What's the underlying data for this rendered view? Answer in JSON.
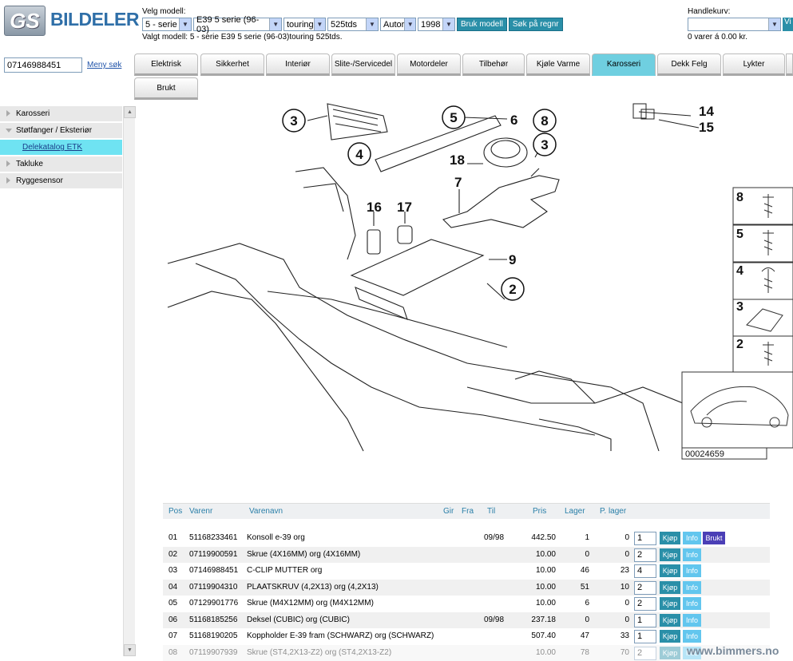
{
  "header": {
    "logo_mark": "GS",
    "logo_text": "BILDELER",
    "model_label": "Velg modell:",
    "selects": [
      {
        "value": "5 - serie"
      },
      {
        "value": "E39 5 serie (96-03)"
      },
      {
        "value": "touring"
      },
      {
        "value": "525tds"
      },
      {
        "value": "Autor"
      },
      {
        "value": "1998"
      }
    ],
    "use_model_button": "Bruk modell",
    "search_reg_button": "Søk på regnr",
    "selected_model": "Valgt modell: 5 - serie E39 5 serie (96-03)touring 525tds.",
    "cart_label": "Handlekurv:",
    "cart_select_value": "",
    "cart_button": "Vi",
    "cart_status": "0 varer á 0.00 kr."
  },
  "search": {
    "value": "07146988451",
    "menu_search_link": "Meny søk"
  },
  "tabs": [
    {
      "label": "Elektrisk"
    },
    {
      "label": "Sikkerhet"
    },
    {
      "label": "Interiør"
    },
    {
      "label": "Slite-/Servicedel"
    },
    {
      "label": "Motordeler"
    },
    {
      "label": "Tilbehør"
    },
    {
      "label": "Kjøle Varme"
    },
    {
      "label": "Karosseri"
    },
    {
      "label": "Dekk Felg"
    },
    {
      "label": "Lykter"
    },
    {
      "label": "Brukt"
    }
  ],
  "active_tab": "Karosseri",
  "sidebar": {
    "items": [
      {
        "label": "Karosseri"
      },
      {
        "label": "Støtfanger / Eksteriør"
      },
      {
        "label": "Delekatalog ETK"
      },
      {
        "label": "Takluke"
      },
      {
        "label": "Ryggesensor"
      }
    ]
  },
  "diagram": {
    "callouts": [
      "3",
      "5",
      "6",
      "8",
      "4",
      "3",
      "18",
      "14",
      "15",
      "7",
      "16",
      "17",
      "9",
      "2"
    ],
    "legend": [
      "8",
      "5",
      "4",
      "3",
      "2"
    ],
    "ref_number": "00024659"
  },
  "table": {
    "headers": [
      "Pos",
      "Varenr",
      "Varenavn",
      "Gir",
      "Fra",
      "Til",
      "Pris",
      "Lager",
      "P. lager"
    ],
    "rows": [
      {
        "pos": "01",
        "varenr": "51168233461",
        "navn": "Konsoll e-39 org",
        "til": "09/98",
        "pris": "442.50",
        "lager": "1",
        "plager": "0",
        "qty": "1",
        "brukt": true
      },
      {
        "pos": "02",
        "varenr": "07119900591",
        "navn": "Skrue (4X16MM) org (4X16MM)",
        "til": "",
        "pris": "10.00",
        "lager": "0",
        "plager": "0",
        "qty": "2",
        "brukt": false
      },
      {
        "pos": "03",
        "varenr": "07146988451",
        "navn": "C-CLIP MUTTER org",
        "til": "",
        "pris": "10.00",
        "lager": "46",
        "plager": "23",
        "qty": "4",
        "brukt": false
      },
      {
        "pos": "04",
        "varenr": "07119904310",
        "navn": "PLAATSKRUV (4,2X13) org (4,2X13)",
        "til": "",
        "pris": "10.00",
        "lager": "51",
        "plager": "10",
        "qty": "2",
        "brukt": false
      },
      {
        "pos": "05",
        "varenr": "07129901776",
        "navn": "Skrue (M4X12MM) org (M4X12MM)",
        "til": "",
        "pris": "10.00",
        "lager": "6",
        "plager": "0",
        "qty": "2",
        "brukt": false
      },
      {
        "pos": "06",
        "varenr": "51168185256",
        "navn": "Deksel (CUBIC) org (CUBIC)",
        "til": "09/98",
        "pris": "237.18",
        "lager": "0",
        "plager": "0",
        "qty": "1",
        "brukt": false
      },
      {
        "pos": "07",
        "varenr": "51168190205",
        "navn": "Koppholder E-39 fram (SCHWARZ) org (SCHWARZ)",
        "til": "",
        "pris": "507.40",
        "lager": "47",
        "plager": "33",
        "qty": "1",
        "brukt": false
      },
      {
        "pos": "08",
        "varenr": "07119907939",
        "navn": "Skrue (ST4,2X13-Z2) org (ST4,2X13-Z2)",
        "til": "",
        "pris": "10.00",
        "lager": "78",
        "plager": "70",
        "qty": "2",
        "brukt": false
      }
    ],
    "buy_label": "Kjøp",
    "info_label": "Info",
    "used_label": "Brukt"
  },
  "watermark": "www.bimmers.no"
}
